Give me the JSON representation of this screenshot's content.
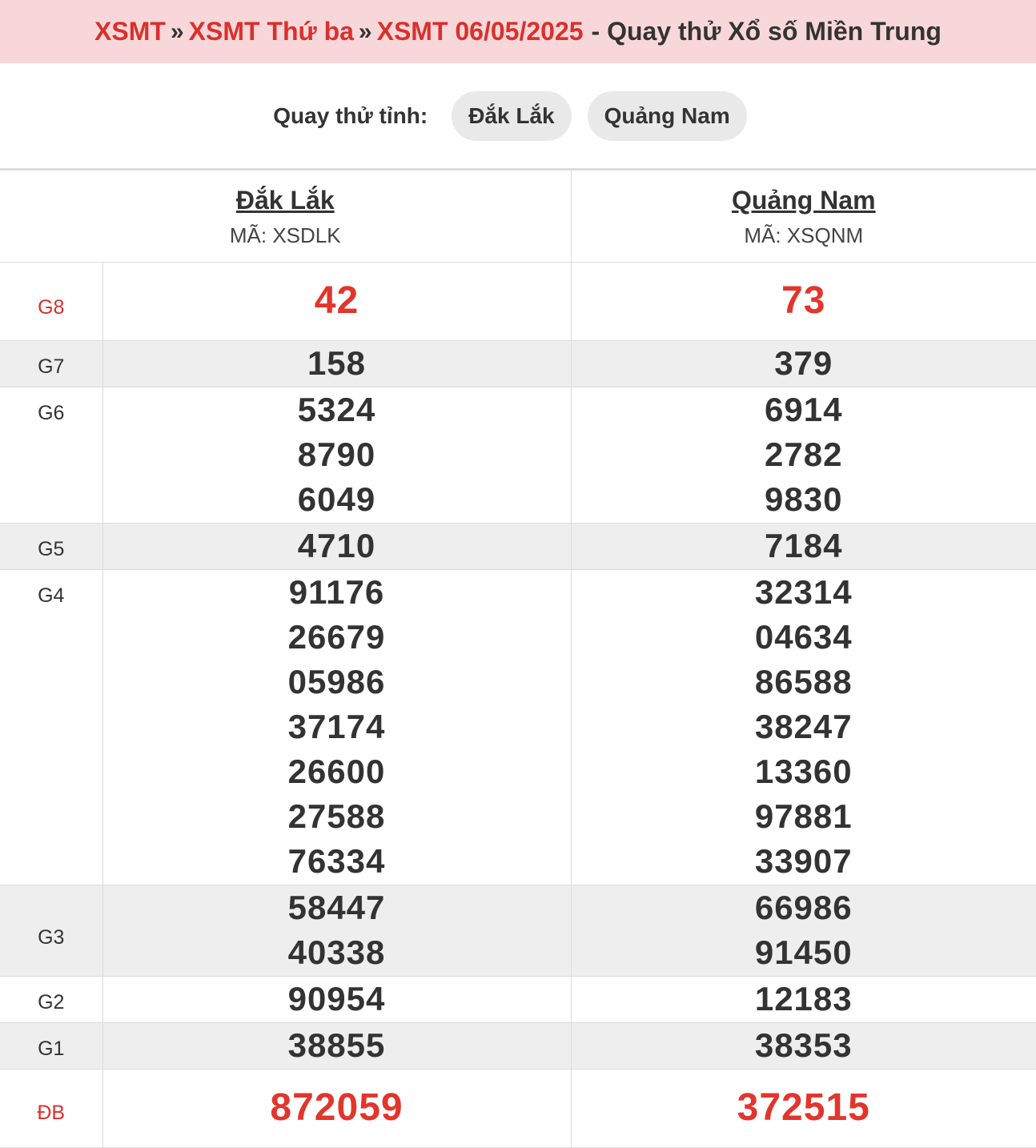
{
  "breadcrumb": {
    "link1": "XSMT",
    "link2": "XSMT Thứ ba",
    "link3": "XSMT 06/05/2025",
    "separator": "»",
    "rest": "- Quay thử Xổ số Miền Trung"
  },
  "selector": {
    "label": "Quay thử tỉnh:",
    "options": [
      "Đắk Lắk",
      "Quảng Nam"
    ]
  },
  "provinces": [
    {
      "name": "Đắk Lắk",
      "code": "MÃ: XSDLK"
    },
    {
      "name": "Quảng Nam",
      "code": "MÃ: XSQNM"
    }
  ],
  "prizes": {
    "g8": {
      "label": "G8",
      "p1": [
        "42"
      ],
      "p2": [
        "73"
      ]
    },
    "g7": {
      "label": "G7",
      "p1": [
        "158"
      ],
      "p2": [
        "379"
      ]
    },
    "g6": {
      "label": "G6",
      "p1": [
        "5324",
        "8790",
        "6049"
      ],
      "p2": [
        "6914",
        "2782",
        "9830"
      ]
    },
    "g5": {
      "label": "G5",
      "p1": [
        "4710"
      ],
      "p2": [
        "7184"
      ]
    },
    "g4": {
      "label": "G4",
      "p1": [
        "91176",
        "26679",
        "05986",
        "37174",
        "26600",
        "27588",
        "76334"
      ],
      "p2": [
        "32314",
        "04634",
        "86588",
        "38247",
        "13360",
        "97881",
        "33907"
      ]
    },
    "g3": {
      "label": "G3",
      "p1": [
        "58447",
        "40338"
      ],
      "p2": [
        "66986",
        "91450"
      ]
    },
    "g2": {
      "label": "G2",
      "p1": [
        "90954"
      ],
      "p2": [
        "12183"
      ]
    },
    "g1": {
      "label": "G1",
      "p1": [
        "38855"
      ],
      "p2": [
        "38353"
      ]
    },
    "db": {
      "label": "ĐB",
      "p1": [
        "872059"
      ],
      "p2": [
        "372515"
      ]
    }
  },
  "colors": {
    "accent_red": "#d9302c",
    "breadcrumb_bg": "#f8d7da",
    "alt_row_bg": "#eeeeee"
  }
}
